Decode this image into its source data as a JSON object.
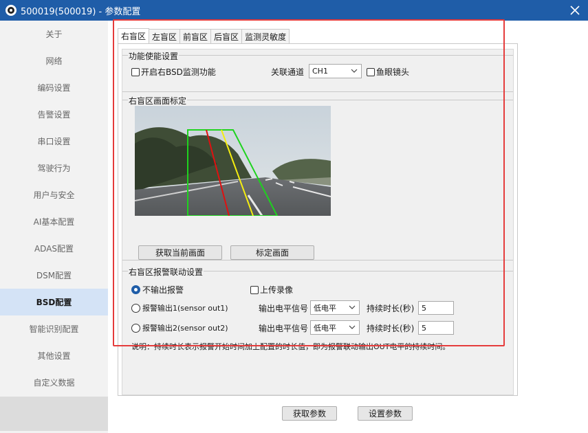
{
  "window": {
    "title": "500019(500019) - 参数配置",
    "icon": "camera-app-icon"
  },
  "sidebar": {
    "items": [
      {
        "label": "关于"
      },
      {
        "label": "网络"
      },
      {
        "label": "编码设置"
      },
      {
        "label": "告警设置"
      },
      {
        "label": "串口设置"
      },
      {
        "label": "驾驶行为"
      },
      {
        "label": "用户与安全"
      },
      {
        "label": "AI基本配置"
      },
      {
        "label": "ADAS配置"
      },
      {
        "label": "DSM配置"
      },
      {
        "label": "BSD配置"
      },
      {
        "label": "智能识别配置"
      },
      {
        "label": "其他设置"
      },
      {
        "label": "自定义数据"
      }
    ],
    "active_index": 10
  },
  "tabs": [
    "右盲区",
    "左盲区",
    "前盲区",
    "后盲区",
    "监测灵敏度"
  ],
  "function_group": {
    "title": "功能使能设置",
    "enable_label": "开启右BSD监测功能",
    "channel_label": "关联通道",
    "channel_value": "CH1",
    "fisheye_label": "鱼眼镜头"
  },
  "calibration_group": {
    "title": "右盲区画面标定",
    "capture_button": "获取当前画面",
    "calibrate_button": "标定画面"
  },
  "alarm_group": {
    "title": "右盲区报警联动设置",
    "no_output_label": "不输出报警",
    "upload_label": "上传录像",
    "output1_label": "报警输出1(sensor out1)",
    "output2_label": "报警输出2(sensor out2)",
    "level_label": "输出电平信号",
    "level1_value": "低电平",
    "level2_value": "低电平",
    "duration_label": "持续时长(秒)",
    "duration1_value": "5",
    "duration2_value": "5",
    "note": "说明：持续时长表示报警开始时间加上配置的时长值，即为报警联动输出OUT电平的持续时间。"
  },
  "footer": {
    "get_button": "获取参数",
    "set_button": "设置参数"
  },
  "colors": {
    "titlebar": "#1f5da8",
    "active_nav": "#d4e3f6",
    "highlight": "#e53b3b"
  }
}
